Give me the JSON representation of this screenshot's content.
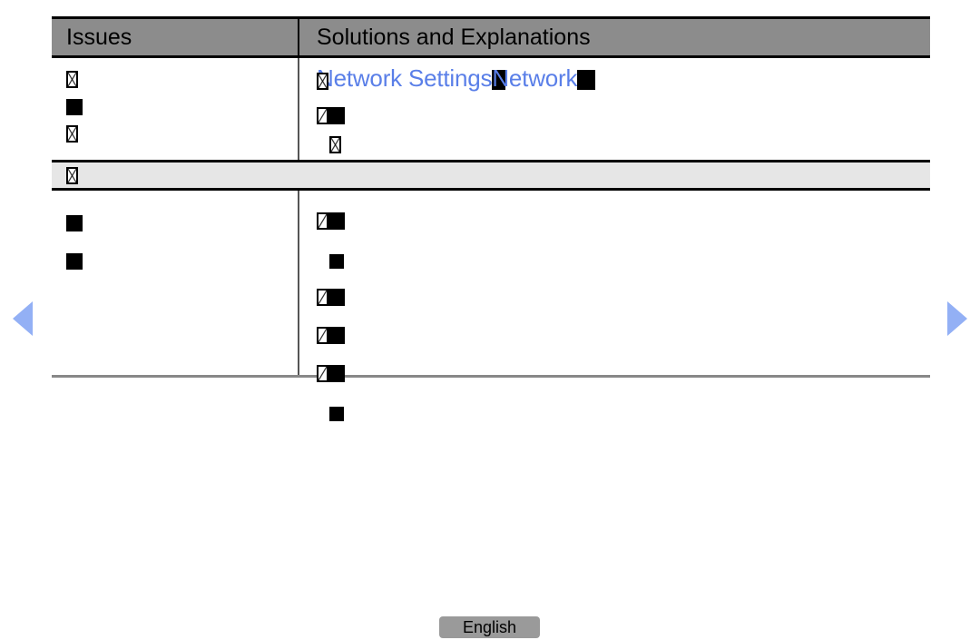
{
  "table": {
    "headers": {
      "issues": "Issues",
      "solutions": "Solutions and Explanations"
    },
    "sections": [
      {
        "id": "section-1",
        "left_items": [
          {
            "glyph": "tofu"
          },
          {
            "glyph": "black-box"
          },
          {
            "glyph": "tofu"
          }
        ],
        "right_link_line": {
          "text_1": "Network Settings",
          "text_2": "Network",
          "color": "#5a7fe8"
        },
        "right_items": [
          {
            "glyph": "tofu-black-box"
          },
          {
            "glyph": "tofu"
          }
        ]
      },
      {
        "id": "banner",
        "glyph": "tofu"
      },
      {
        "id": "section-2",
        "left_items": [
          {
            "glyph": "black-box"
          },
          {
            "glyph": "black-box"
          }
        ],
        "right_items": [
          {
            "glyph": "tofu-black-box"
          },
          {
            "glyph": "black-box"
          },
          {
            "glyph": "tofu-black-box"
          },
          {
            "glyph": "tofu-black-box"
          },
          {
            "glyph": "tofu-black-box"
          },
          {
            "glyph": "black-box"
          }
        ]
      }
    ]
  },
  "navigation": {
    "previous_label": "",
    "next_label": "",
    "arrow_color": "#93b0f5"
  },
  "footer": {
    "language": "English",
    "button_color": "#9a9a9a"
  },
  "colors": {
    "header_background": "#8c8c8c",
    "banner_background": "#e6e6e6",
    "link_blue": "#5a7fe8",
    "page_background": "#ffffff"
  }
}
